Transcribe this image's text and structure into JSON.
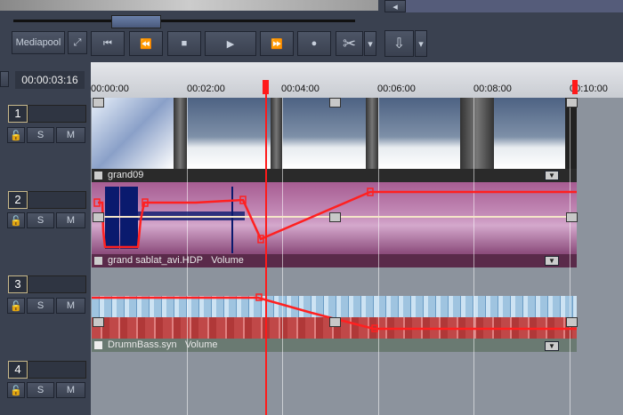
{
  "toolbar": {
    "mediapool": "Mediapool",
    "timecode": "00:00:03:16"
  },
  "ruler": {
    "ticks": [
      "00:00:00",
      "00:02:00",
      "00:04:00",
      "00:06:00",
      "00:08:00",
      "00:10:00"
    ]
  },
  "tracks": [
    {
      "number": "1",
      "lock": "🔓",
      "solo": "S",
      "mute": "M"
    },
    {
      "number": "2",
      "lock": "🔓",
      "solo": "S",
      "mute": "M"
    },
    {
      "number": "3",
      "lock": "🔓",
      "solo": "S",
      "mute": "M"
    },
    {
      "number": "4",
      "lock": "🔓",
      "solo": "S",
      "mute": "M"
    }
  ],
  "clips": {
    "video": "grand09",
    "audio": "grand sablat_avi.HDP",
    "audio_curve": "Volume",
    "music": "DrumnBass.syn",
    "music_curve": "Volume"
  },
  "colors": {
    "playhead": "#ff1a1a",
    "audio_bg": "#b0709e",
    "curve": "#ff2020"
  }
}
